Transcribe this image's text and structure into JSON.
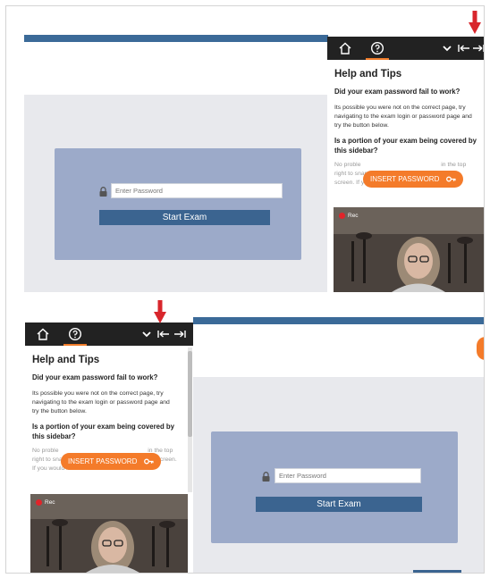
{
  "sidebar": {
    "title": "Help and Tips",
    "question1": "Did your exam password fail to work?",
    "answer1": "Its possible you were not on the correct page, try navigating to the exam login or password page and try the button below.",
    "question2": "Is a portion of your exam being covered by this sidebar?",
    "answer2_start": "No proble",
    "answer2_rest": "in the top right to snap this sidebar to either side of your screen. If you would like to reduce the",
    "insert_password_label": "INSERT PASSWORD"
  },
  "exam": {
    "password_placeholder": "Enter Password",
    "start_label": "Start Exam"
  },
  "video": {
    "rec_label": "Rec"
  },
  "colors": {
    "accent": "#f47b2a",
    "sidebar_header": "#222222",
    "brand_blue": "#3b6490",
    "login_box": "#9caac9",
    "rec_dot": "#e0242a",
    "annotation_arrow": "#d8262c"
  },
  "icons": [
    "home-icon",
    "help-icon",
    "chevron-down-icon",
    "snap-left-icon",
    "snap-right-icon",
    "lock-icon",
    "key-icon",
    "red-down-arrow-icon"
  ]
}
